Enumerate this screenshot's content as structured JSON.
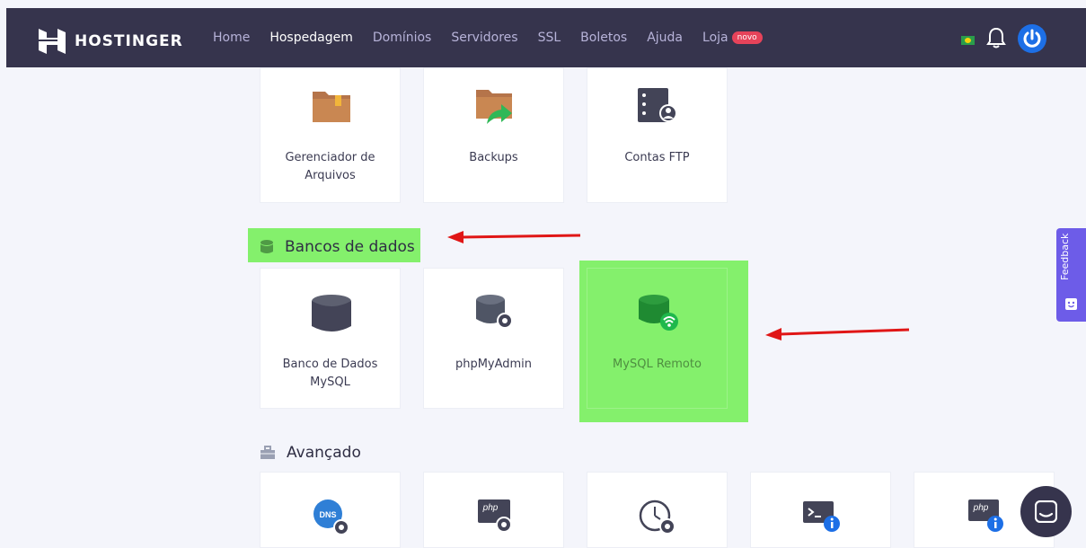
{
  "header": {
    "brand": "HOSTINGER",
    "nav": [
      {
        "label": "Home",
        "active": false
      },
      {
        "label": "Hospedagem",
        "active": true
      },
      {
        "label": "Domínios",
        "active": false
      },
      {
        "label": "Servidores",
        "active": false
      },
      {
        "label": "SSL",
        "active": false
      },
      {
        "label": "Boletos",
        "active": false
      },
      {
        "label": "Ajuda",
        "active": false
      },
      {
        "label": "Loja",
        "active": false,
        "badge": "novo"
      }
    ]
  },
  "files_section": {
    "cards": [
      {
        "label_line1": "Gerenciador de",
        "label_line2": "Arquivos",
        "icon": "folder-icon"
      },
      {
        "label": "Backups",
        "icon": "folder-backup-icon"
      },
      {
        "label": "Contas FTP",
        "icon": "ftp-server-icon"
      }
    ]
  },
  "databases_section": {
    "title": "Bancos de dados",
    "cards": [
      {
        "label_line1": "Banco de Dados",
        "label_line2": "MySQL",
        "icon": "database-icon"
      },
      {
        "label": "phpMyAdmin",
        "icon": "database-gear-icon"
      },
      {
        "label": "MySQL Remoto",
        "icon": "database-remote-icon",
        "highlighted": true
      }
    ]
  },
  "advanced_section": {
    "title": "Avançado",
    "cards": [
      {
        "icon": "dns-gear-icon",
        "icon_text": "DNS"
      },
      {
        "icon": "php-gear-icon",
        "icon_text": "php"
      },
      {
        "icon": "clock-gear-icon"
      },
      {
        "icon": "terminal-info-icon"
      },
      {
        "icon": "php-info-icon",
        "icon_text": "php"
      }
    ]
  },
  "feedback": {
    "label": "Feedback"
  },
  "colors": {
    "header": "#36344d",
    "highlight": "#84f06c",
    "arrow": "#e01616",
    "feedback": "#6d5ce8"
  }
}
